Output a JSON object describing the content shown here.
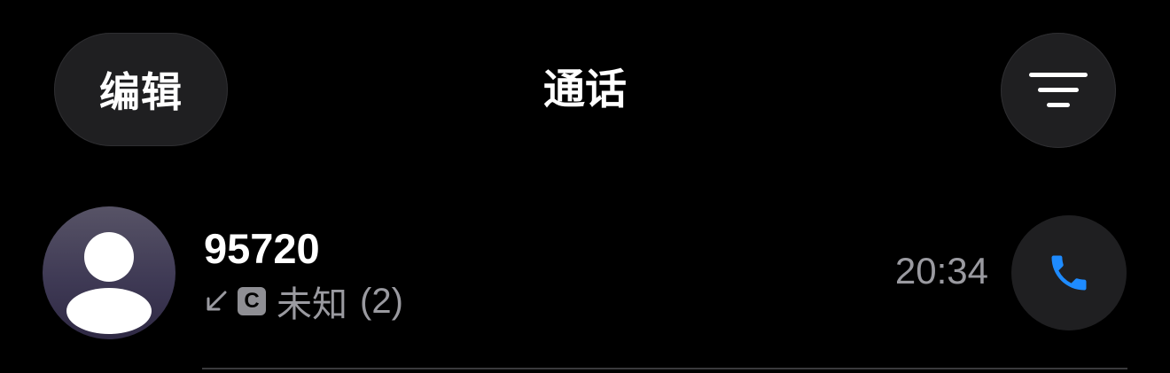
{
  "header": {
    "edit_label": "编辑",
    "title": "通话",
    "filter_icon": "filter-lines-icon"
  },
  "call_log": [
    {
      "name": "95720",
      "direction_icon": "incoming-arrow-icon",
      "sim_label": "C",
      "call_type": "未知",
      "count": "(2)",
      "time": "20:34",
      "action_icon": "phone-icon"
    }
  ],
  "colors": {
    "background": "#000000",
    "button_bg": "#1f1f21",
    "secondary_text": "#9a9aa0",
    "accent_blue": "#1e8bff",
    "avatar_bg": "#3f3a55"
  }
}
